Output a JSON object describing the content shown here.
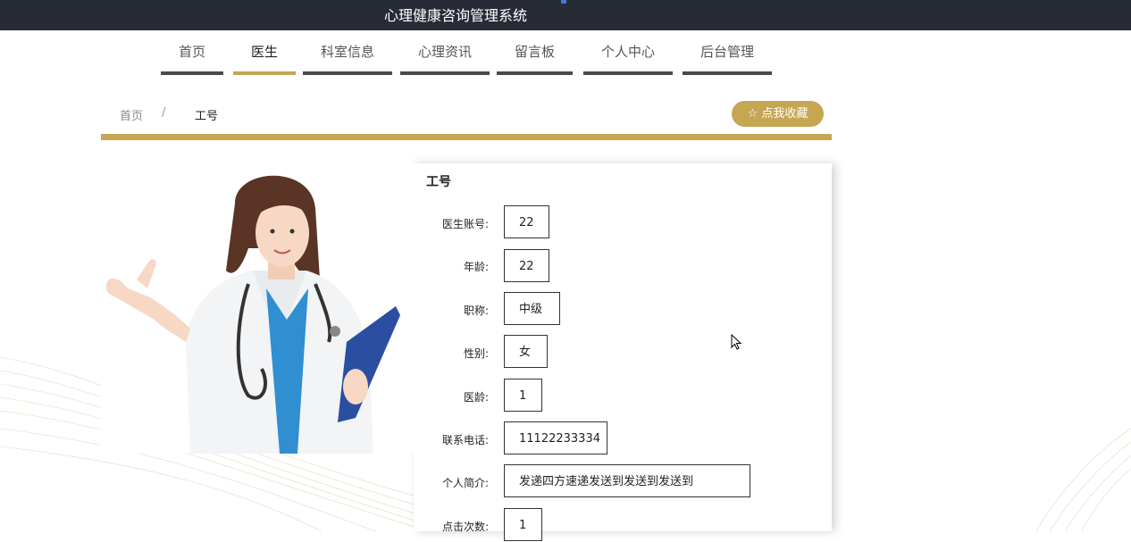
{
  "header": {
    "title": "心理健康咨询管理系统"
  },
  "nav": {
    "items": [
      {
        "label": "首页",
        "active": false
      },
      {
        "label": "医生",
        "active": true
      },
      {
        "label": "科室信息",
        "active": false
      },
      {
        "label": "心理资讯",
        "active": false
      },
      {
        "label": "留言板",
        "active": false
      },
      {
        "label": "个人中心",
        "active": false
      },
      {
        "label": "后台管理",
        "active": false
      }
    ]
  },
  "breadcrumb": {
    "home": "首页",
    "separator": "/",
    "current": "工号"
  },
  "favorite_button": {
    "label": "☆ 点我收藏"
  },
  "detail": {
    "title": "工号",
    "fields": [
      {
        "label": "医生账号:",
        "value": "22"
      },
      {
        "label": "年龄:",
        "value": "22"
      },
      {
        "label": "职称:",
        "value": "中级"
      },
      {
        "label": "性别:",
        "value": "女"
      },
      {
        "label": "医龄:",
        "value": "1"
      },
      {
        "label": "联系电话:",
        "value": "11122233334"
      },
      {
        "label": "个人简介:",
        "value": "发递四方速递发送到发送到发送到"
      },
      {
        "label": "点击次数:",
        "value": "1"
      }
    ]
  },
  "colors": {
    "accent": "#c6a653",
    "topbar": "#262b36",
    "nav_underline": "#4a4a4a"
  }
}
